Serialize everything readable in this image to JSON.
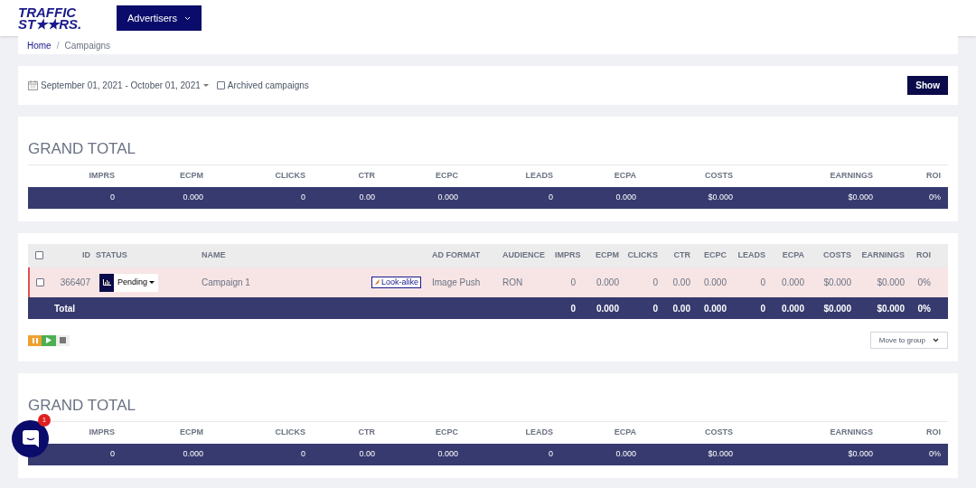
{
  "header": {
    "logo_lines": [
      "TRAFFIC",
      "ST★★RS."
    ],
    "menu": {
      "label": "Advertisers"
    }
  },
  "breadcrumb": [
    {
      "label": "Home",
      "kind": "link"
    },
    {
      "label": "/",
      "kind": "separator"
    },
    {
      "label": "Campaigns",
      "kind": "current"
    }
  ],
  "filters": {
    "date_range": "September 01, 2021 - October 01, 2021",
    "archived": {
      "label": "Archived campaigns",
      "checked": false
    },
    "show_button": "Show"
  },
  "grand_total_top": {
    "title": "GRAND TOTAL",
    "columns": [
      "IMPRS",
      "ECPM",
      "CLICKS",
      "CTR",
      "ECPC",
      "LEADS",
      "ECPA",
      "COSTS",
      "EARNINGS",
      "ROI"
    ],
    "values": [
      "0",
      "0.000",
      "0",
      "0.00",
      "0.000",
      "0",
      "0.000",
      "$0.000",
      "$0.000",
      "0%"
    ]
  },
  "campaigns": {
    "columns": [
      "ID",
      "STATUS",
      "NAME",
      "AD FORMAT",
      "AUDIENCE",
      "IMPRS",
      "ECPM",
      "CLICKS",
      "CTR",
      "ECPC",
      "LEADS",
      "ECPA",
      "COSTS",
      "EARNINGS",
      "ROI"
    ],
    "select_all_checked": false,
    "rows": [
      {
        "checked": false,
        "id": "366407",
        "status": "Pending",
        "name": "Campaign 1",
        "tag": "Look-alike",
        "ad_format": "Image Push",
        "audience": "RON",
        "stats": [
          "0",
          "0.000",
          "0",
          "0.00",
          "0.000",
          "0",
          "0.000",
          "$0.000",
          "$0.000",
          "0%"
        ]
      }
    ],
    "total": {
      "label": "Total",
      "stats": [
        "0",
        "0.000",
        "0",
        "0.00",
        "0.000",
        "0",
        "0.000",
        "$0.000",
        "$0.000",
        "0%"
      ]
    },
    "move_to_group": "Move to group"
  },
  "grand_total_bottom": {
    "title": "GRAND TOTAL",
    "columns": [
      "IMPRS",
      "ECPM",
      "CLICKS",
      "CTR",
      "ECPC",
      "LEADS",
      "ECPA",
      "COSTS",
      "EARNINGS",
      "ROI"
    ],
    "values": [
      "0",
      "0.000",
      "0",
      "0.00",
      "0.000",
      "0",
      "0.000",
      "$0.000",
      "$0.000",
      "0%"
    ]
  },
  "chat": {
    "badge": "1"
  }
}
